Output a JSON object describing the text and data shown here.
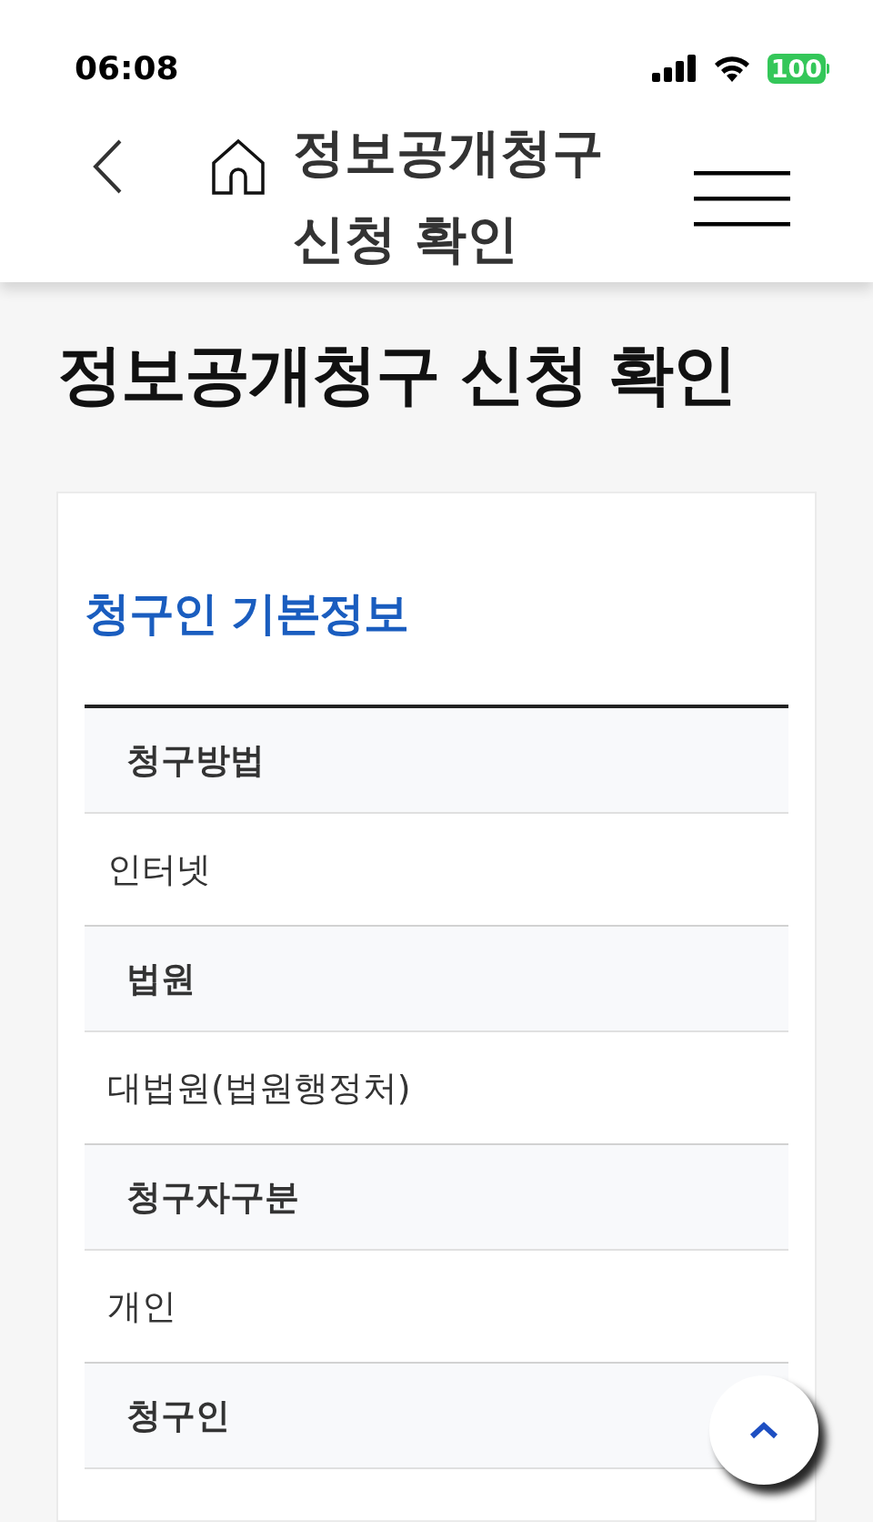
{
  "status_bar": {
    "time": "06:08",
    "battery": "100"
  },
  "header": {
    "title": "정보공개청구 신청 확인"
  },
  "page_title": "정보공개청구 신청 확인",
  "section": {
    "title": "청구인 기본정보",
    "fields": [
      {
        "label": "청구방법",
        "value": "인터넷"
      },
      {
        "label": "법원",
        "value": "대법원(법원행정처)"
      },
      {
        "label": "청구자구분",
        "value": "개인"
      },
      {
        "label": "청구인"
      }
    ]
  }
}
